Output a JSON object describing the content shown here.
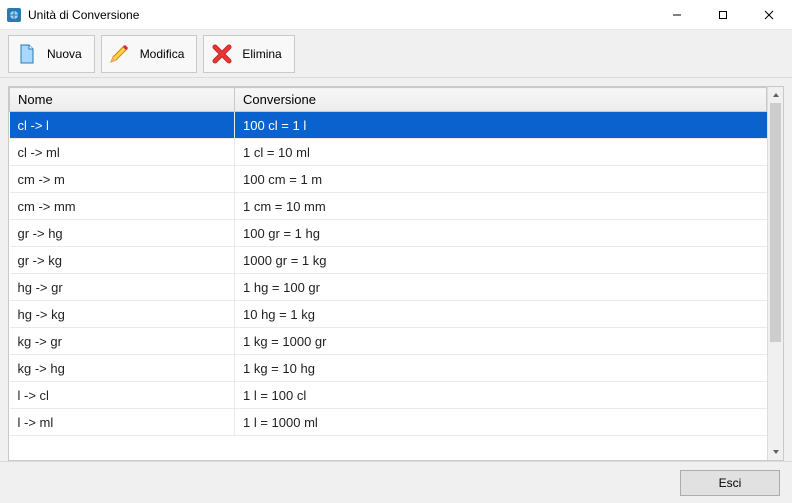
{
  "window": {
    "title": "Unità di Conversione"
  },
  "toolbar": {
    "new_label": "Nuova",
    "edit_label": "Modifica",
    "delete_label": "Elimina"
  },
  "grid": {
    "columns": {
      "name": "Nome",
      "conversion": "Conversione"
    },
    "rows": [
      {
        "name": "cl -> l",
        "conversion": "100 cl = 1 l",
        "selected": true
      },
      {
        "name": "cl -> ml",
        "conversion": "1 cl = 10 ml",
        "selected": false
      },
      {
        "name": "cm -> m",
        "conversion": "100 cm = 1 m",
        "selected": false
      },
      {
        "name": "cm -> mm",
        "conversion": "1 cm = 10 mm",
        "selected": false
      },
      {
        "name": "gr -> hg",
        "conversion": "100 gr = 1 hg",
        "selected": false
      },
      {
        "name": "gr -> kg",
        "conversion": "1000 gr = 1 kg",
        "selected": false
      },
      {
        "name": "hg -> gr",
        "conversion": "1 hg = 100 gr",
        "selected": false
      },
      {
        "name": "hg -> kg",
        "conversion": "10 hg = 1 kg",
        "selected": false
      },
      {
        "name": "kg -> gr",
        "conversion": "1 kg = 1000 gr",
        "selected": false
      },
      {
        "name": "kg -> hg",
        "conversion": "1 kg = 10 hg",
        "selected": false
      },
      {
        "name": "l -> cl",
        "conversion": "1 l = 100 cl",
        "selected": false
      },
      {
        "name": "l -> ml",
        "conversion": "1 l = 1000 ml",
        "selected": false
      }
    ]
  },
  "footer": {
    "exit_label": "Esci"
  }
}
